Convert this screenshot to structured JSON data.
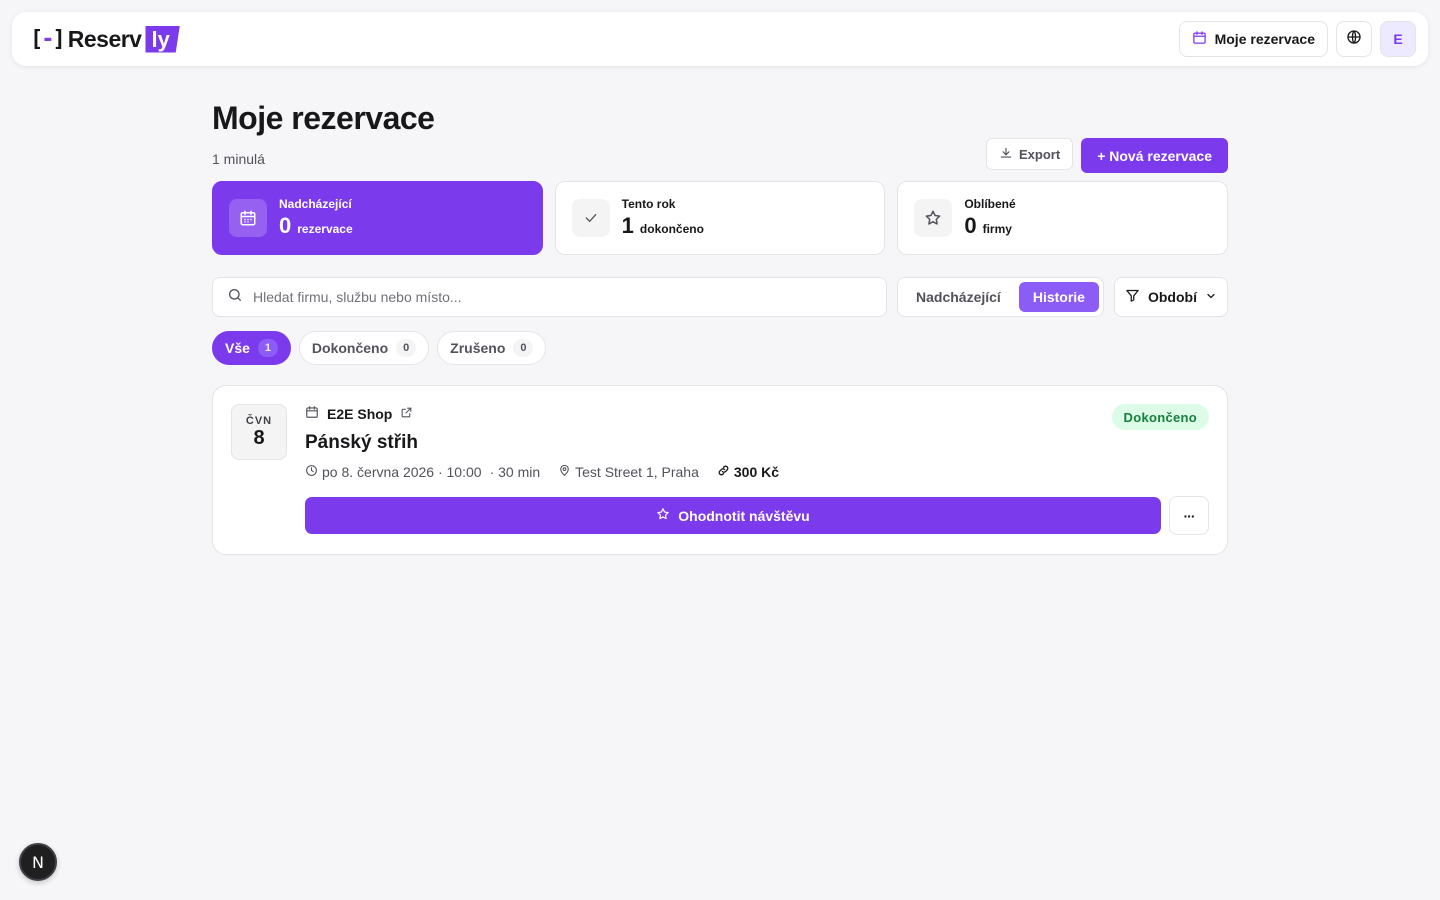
{
  "app": {
    "logo_mark_left": "[",
    "logo_mark_dash": "-",
    "logo_mark_right": "]",
    "logo_text": "Reserv",
    "logo_badge": "ly",
    "brand_color": "#7c3aed"
  },
  "nav": {
    "reservations_label": "Moje rezervace",
    "avatar_initial": "E"
  },
  "header": {
    "title": "Moje rezervace",
    "subtitle": "1 minulá",
    "export_label": "Export",
    "new_label": "+ Nová rezervace"
  },
  "stats": [
    {
      "label": "Nadcházející",
      "value": "0",
      "unit": "rezervace",
      "icon": "calendar-icon"
    },
    {
      "label": "Tento rok",
      "value": "1",
      "unit": "dokončeno",
      "icon": "check-icon"
    },
    {
      "label": "Oblíbené",
      "value": "0",
      "unit": "firmy",
      "icon": "star-icon"
    }
  ],
  "filters": {
    "search_placeholder": "Hledat firmu, službu nebo místo...",
    "segment_upcoming": "Nadcházející",
    "segment_history": "Historie",
    "period_label": "Období"
  },
  "chips": [
    {
      "label": "Vše",
      "count": "1"
    },
    {
      "label": "Dokončeno",
      "count": "0"
    },
    {
      "label": "Zrušeno",
      "count": "0"
    }
  ],
  "booking": {
    "month": "ČVN",
    "day": "8",
    "business": "E2E Shop",
    "service": "Pánský střih",
    "datetime": "po 8. června 2026 · 10:00",
    "duration": "· 30 min",
    "location": "Test Street 1, Praha",
    "price": "300 Kč",
    "status": "Dokončeno",
    "rate_label": "Ohodnotit návštěvu",
    "more_label": "···"
  },
  "next_badge": "N"
}
